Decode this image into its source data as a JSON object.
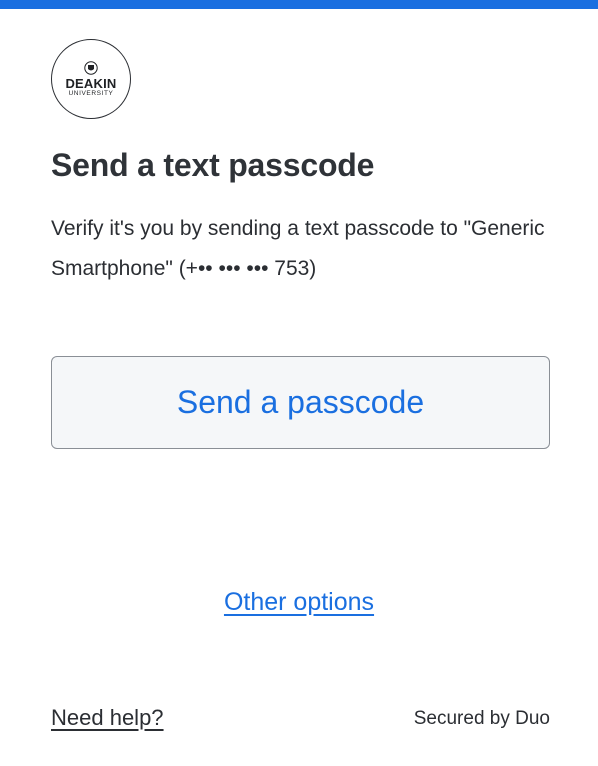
{
  "brand": {
    "accent_color": "#1a6fe0",
    "logo_name": "DEAKIN",
    "logo_sub": "UNIVERSITY"
  },
  "main": {
    "title": "Send a text passcode",
    "description": "Verify it's you by sending a text passcode to \"Generic Smartphone\" (+•• ••• ••• 753)",
    "send_button_label": "Send a passcode",
    "other_options_label": "Other options"
  },
  "footer": {
    "need_help_label": "Need help?",
    "secured_by": "Secured by Duo"
  }
}
